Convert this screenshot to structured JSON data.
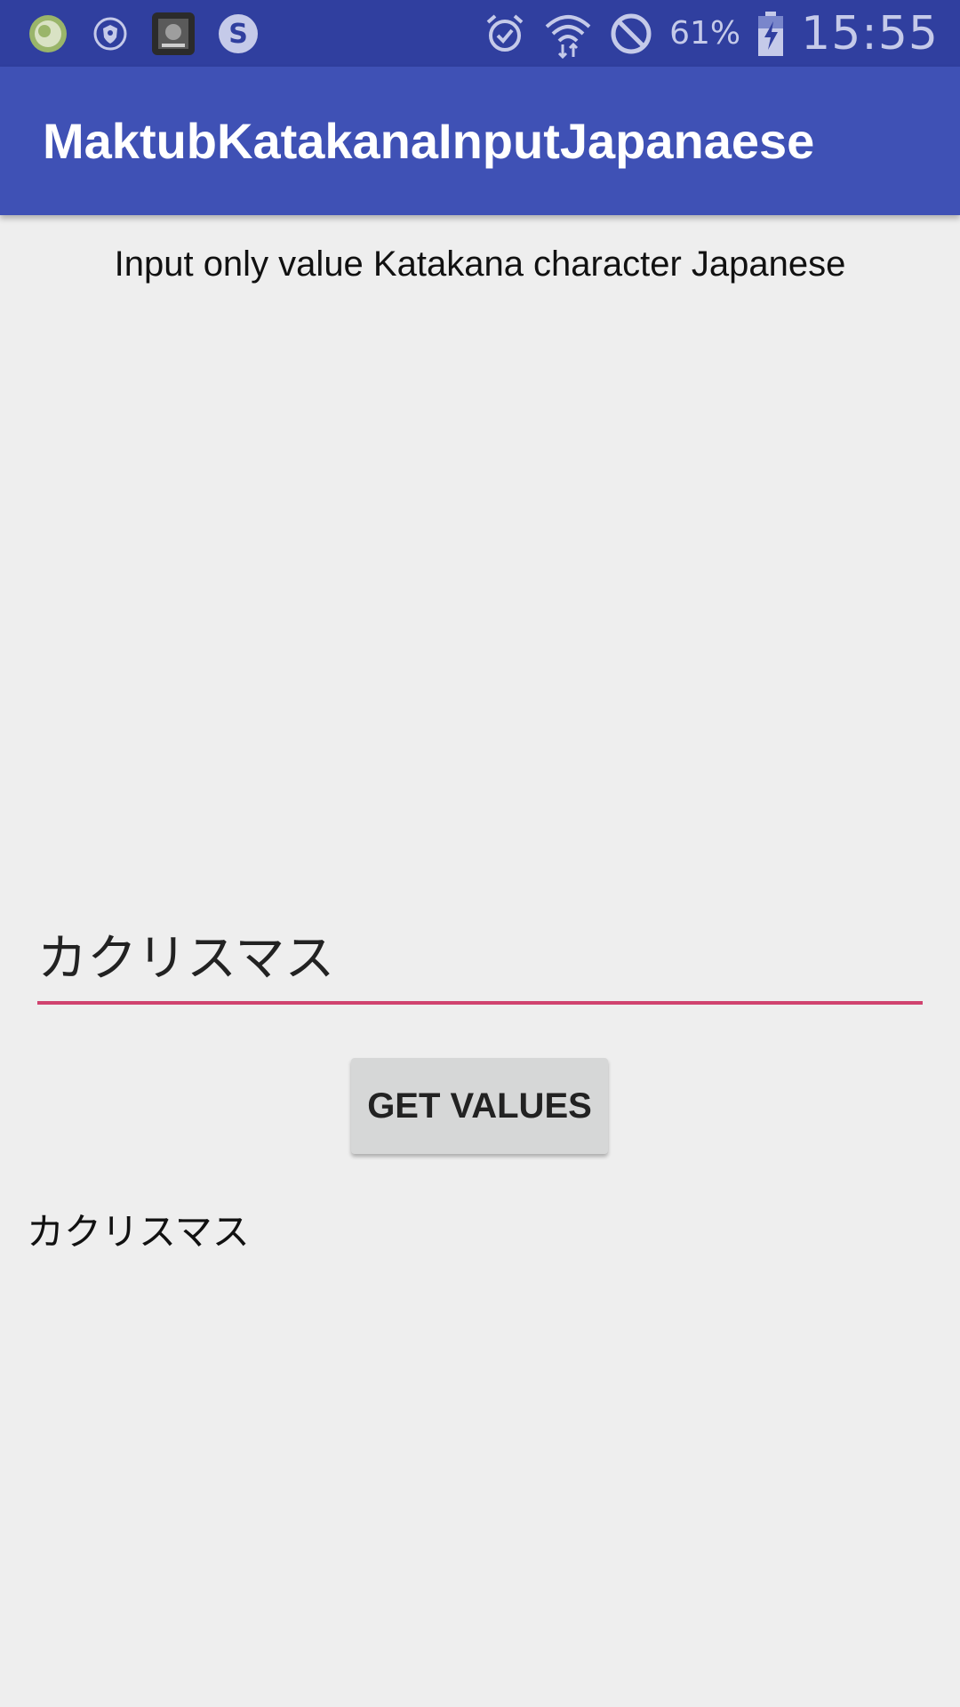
{
  "status_bar": {
    "left_icons": [
      "green-circle-app-icon",
      "shield-app-icon",
      "photo-app-icon",
      "skype-icon"
    ],
    "right_icons": [
      "alarm-icon",
      "wifi-icon",
      "do-not-disturb-icon"
    ],
    "battery": "61%",
    "time": "15:55"
  },
  "app_bar": {
    "title": "MaktubKatakanaInputJapanaese"
  },
  "main": {
    "subtitle": "Input only value Katakana character Japanese",
    "input": {
      "value": "カクリスマス",
      "placeholder": ""
    },
    "button_label": "GET VALUES",
    "result": "カクリスマス"
  },
  "colors": {
    "status_bar": "#303f9f",
    "app_bar": "#3f51b5",
    "accent": "#d0436f",
    "background": "#eeeeee"
  }
}
